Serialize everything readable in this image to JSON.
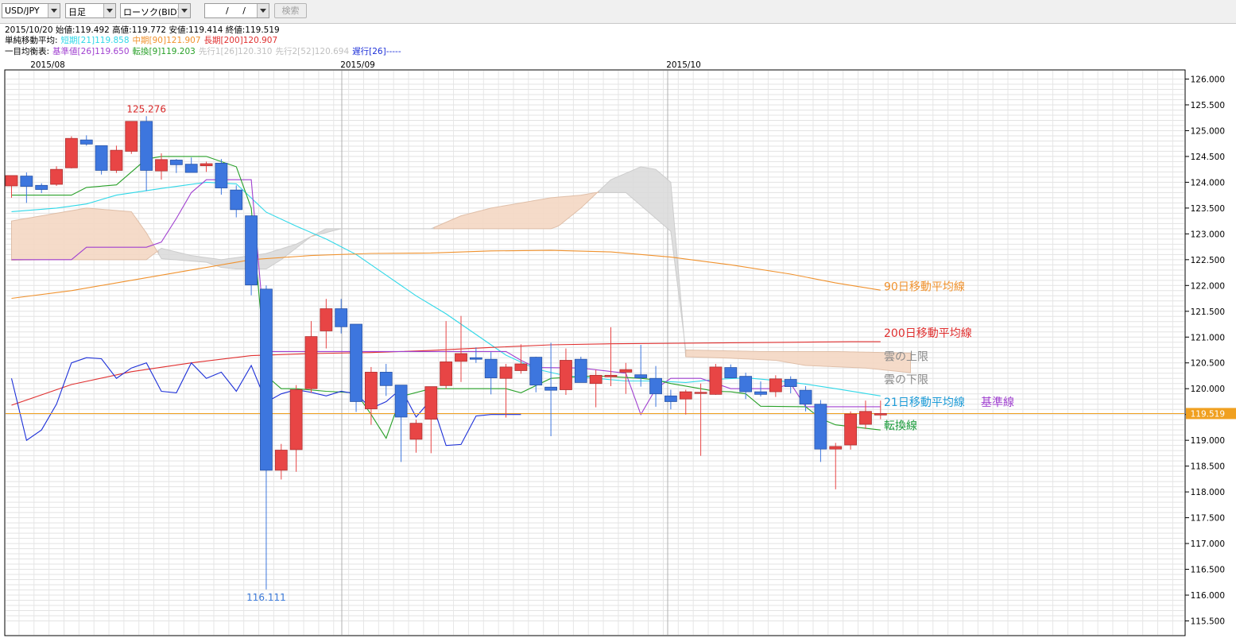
{
  "toolbar": {
    "pair": "USD/JPY",
    "period": "日足",
    "chart_type": "ローソク(BID)",
    "date_value": "/ /",
    "search_label": "検索"
  },
  "info": {
    "ohlc": "2015/10/20  始値:119.492  高値:119.772  安値:119.414  終値:119.519",
    "sma_label": "単純移動平均:",
    "sma_short": "短期[21]119.858",
    "sma_mid": "中期[90]121.907",
    "sma_long": "長期[200]120.907",
    "ichi_label": "一目均衡表:",
    "ichi_kijun": "基準値[26]119.650",
    "ichi_tenkan": "転換[9]119.203",
    "ichi_senko1": "先行1[26]120.310",
    "ichi_senko2": "先行2[52]120.694",
    "ichi_chikou": "遅行[26]-----"
  },
  "colors": {
    "up": "#e84545",
    "down": "#3d76de",
    "sma21": "#2fd8e8",
    "sma90": "#f0922e",
    "sma200": "#e03030",
    "kijun": "#a040d0",
    "tenkan": "#28a028",
    "chikou": "#1c2fd8",
    "cloud_up": "#f5d8c4",
    "cloud_down": "#dcdcdc",
    "price_line": "#f0a020",
    "green_text": "#1a9a3a"
  },
  "chart_data": {
    "type": "candlestick",
    "x_tick_labels": [
      "2015/08",
      "2015/09",
      "2015/10"
    ],
    "y_ticks": [
      "126.000",
      "125.500",
      "125.000",
      "124.500",
      "124.000",
      "123.500",
      "123.000",
      "122.500",
      "122.000",
      "121.500",
      "121.000",
      "120.500",
      "120.000",
      "119.500",
      "119.000",
      "118.500",
      "118.000",
      "117.500",
      "117.000",
      "116.500",
      "116.000",
      "115.500"
    ],
    "ylim": [
      115.5,
      126.0
    ],
    "high_label": "125.276",
    "low_label": "116.111",
    "last_price": 119.519,
    "last_price_label": "119.519",
    "candles": [
      [
        123.93,
        124.1,
        123.7,
        124.13
      ],
      [
        124.12,
        124.19,
        123.6,
        123.92
      ],
      [
        123.94,
        123.98,
        123.79,
        123.86
      ],
      [
        123.96,
        124.31,
        123.93,
        124.25
      ],
      [
        124.28,
        124.89,
        124.27,
        124.85
      ],
      [
        124.82,
        124.91,
        124.71,
        124.74
      ],
      [
        124.71,
        124.71,
        124.15,
        124.23
      ],
      [
        124.23,
        124.71,
        124.18,
        124.62
      ],
      [
        124.6,
        125.17,
        124.55,
        125.18
      ],
      [
        125.18,
        125.28,
        123.83,
        124.23
      ],
      [
        124.22,
        124.56,
        124.05,
        124.44
      ],
      [
        124.43,
        124.45,
        124.18,
        124.34
      ],
      [
        124.35,
        124.48,
        124.23,
        124.19
      ],
      [
        124.32,
        124.4,
        124.2,
        124.36
      ],
      [
        124.37,
        124.45,
        123.76,
        123.89
      ],
      [
        123.85,
        123.94,
        123.32,
        123.47
      ],
      [
        123.35,
        123.36,
        121.81,
        122.01
      ],
      [
        121.93,
        122.0,
        116.11,
        118.42
      ],
      [
        118.42,
        118.93,
        118.24,
        118.81
      ],
      [
        118.82,
        120.07,
        118.39,
        119.98
      ],
      [
        120.0,
        121.31,
        119.92,
        121.01
      ],
      [
        121.12,
        121.74,
        120.78,
        121.55
      ],
      [
        121.55,
        121.74,
        121.07,
        121.2
      ],
      [
        121.25,
        121.25,
        119.55,
        119.75
      ],
      [
        119.61,
        120.42,
        119.3,
        120.32
      ],
      [
        120.32,
        120.48,
        119.86,
        120.06
      ],
      [
        120.07,
        120.07,
        118.58,
        119.45
      ],
      [
        119.02,
        119.4,
        118.76,
        119.33
      ],
      [
        119.41,
        120.04,
        118.75,
        120.04
      ],
      [
        120.06,
        121.31,
        120.0,
        120.52
      ],
      [
        120.53,
        121.41,
        120.13,
        120.68
      ],
      [
        120.6,
        120.8,
        120.5,
        120.57
      ],
      [
        120.57,
        120.71,
        119.89,
        120.21
      ],
      [
        120.2,
        120.48,
        119.44,
        120.42
      ],
      [
        120.35,
        120.86,
        120.29,
        120.48
      ],
      [
        120.61,
        120.62,
        119.93,
        120.07
      ],
      [
        120.03,
        120.89,
        119.08,
        119.97
      ],
      [
        119.98,
        120.78,
        119.88,
        120.55
      ],
      [
        120.57,
        120.62,
        120.13,
        120.12
      ],
      [
        120.1,
        120.37,
        119.64,
        120.26
      ],
      [
        120.23,
        121.19,
        120.05,
        120.26
      ],
      [
        120.32,
        120.5,
        119.9,
        120.37
      ],
      [
        120.27,
        120.85,
        120.04,
        120.21
      ],
      [
        120.2,
        120.44,
        119.65,
        119.9
      ],
      [
        119.86,
        119.98,
        119.6,
        119.75
      ],
      [
        119.8,
        119.98,
        119.5,
        119.94
      ],
      [
        119.93,
        120.1,
        118.7,
        119.93
      ],
      [
        119.89,
        120.48,
        119.88,
        120.42
      ],
      [
        120.41,
        120.47,
        120.23,
        120.21
      ],
      [
        120.24,
        120.31,
        119.8,
        119.94
      ],
      [
        119.94,
        120.14,
        119.85,
        119.89
      ],
      [
        119.94,
        120.26,
        119.84,
        120.19
      ],
      [
        120.18,
        120.24,
        119.91,
        120.04
      ],
      [
        119.97,
        120.05,
        119.56,
        119.7
      ],
      [
        119.7,
        119.78,
        118.58,
        118.83
      ],
      [
        118.83,
        118.95,
        118.05,
        118.88
      ],
      [
        118.91,
        119.56,
        118.82,
        119.51
      ],
      [
        119.31,
        119.77,
        119.22,
        119.56
      ],
      [
        119.49,
        119.77,
        119.41,
        119.52
      ]
    ],
    "series": [
      {
        "key": "sma21",
        "values": [
          [
            0,
            123.43
          ],
          [
            3,
            123.5
          ],
          [
            5,
            123.58
          ],
          [
            7,
            123.75
          ],
          [
            10,
            123.88
          ],
          [
            13,
            124.0
          ],
          [
            15,
            123.97
          ],
          [
            17,
            123.42
          ],
          [
            19,
            123.15
          ],
          [
            21,
            122.9
          ],
          [
            23,
            122.6
          ],
          [
            25,
            122.2
          ],
          [
            27,
            121.8
          ],
          [
            29,
            121.45
          ],
          [
            31,
            121.05
          ],
          [
            33,
            120.65
          ],
          [
            35,
            120.38
          ],
          [
            37,
            120.25
          ],
          [
            39,
            120.2
          ],
          [
            41,
            120.15
          ],
          [
            43,
            120.15
          ],
          [
            45,
            120.12
          ],
          [
            47,
            120.18
          ],
          [
            49,
            120.21
          ],
          [
            51,
            120.16
          ],
          [
            53,
            120.09
          ],
          [
            55,
            120.0
          ],
          [
            58,
            119.86
          ]
        ]
      },
      {
        "key": "sma90",
        "values": [
          [
            0,
            121.75
          ],
          [
            4,
            121.9
          ],
          [
            8,
            122.1
          ],
          [
            12,
            122.3
          ],
          [
            16,
            122.5
          ],
          [
            20,
            122.58
          ],
          [
            24,
            122.62
          ],
          [
            28,
            122.63
          ],
          [
            32,
            122.67
          ],
          [
            36,
            122.68
          ],
          [
            40,
            122.65
          ],
          [
            44,
            122.55
          ],
          [
            48,
            122.4
          ],
          [
            52,
            122.22
          ],
          [
            55,
            122.05
          ],
          [
            58,
            121.91
          ]
        ]
      },
      {
        "key": "sma200",
        "values": [
          [
            0,
            119.68
          ],
          [
            4,
            120.08
          ],
          [
            8,
            120.33
          ],
          [
            12,
            120.5
          ],
          [
            16,
            120.64
          ],
          [
            20,
            120.68
          ],
          [
            24,
            120.7
          ],
          [
            28,
            120.74
          ],
          [
            32,
            120.8
          ],
          [
            36,
            120.85
          ],
          [
            40,
            120.87
          ],
          [
            44,
            120.88
          ],
          [
            48,
            120.89
          ],
          [
            52,
            120.9
          ],
          [
            56,
            120.91
          ],
          [
            58,
            120.91
          ]
        ]
      },
      {
        "key": "kijun",
        "values": [
          [
            0,
            122.5
          ],
          [
            4,
            122.5
          ],
          [
            5,
            122.74
          ],
          [
            9,
            122.74
          ],
          [
            10,
            122.84
          ],
          [
            11,
            123.3
          ],
          [
            12,
            123.8
          ],
          [
            13,
            124.05
          ],
          [
            14,
            124.05
          ],
          [
            15,
            124.05
          ],
          [
            16,
            124.05
          ],
          [
            17,
            120.72
          ],
          [
            23,
            120.72
          ],
          [
            33,
            120.72
          ],
          [
            34,
            120.55
          ],
          [
            35,
            120.41
          ],
          [
            38,
            120.4
          ],
          [
            41,
            120.3
          ],
          [
            42,
            119.5
          ],
          [
            43,
            120.0
          ],
          [
            44,
            120.2
          ],
          [
            46,
            120.2
          ],
          [
            47,
            120.1
          ],
          [
            48,
            120.0
          ],
          [
            50,
            120.0
          ],
          [
            51,
            120.0
          ],
          [
            52,
            120.1
          ],
          [
            53,
            119.65
          ],
          [
            55,
            119.65
          ],
          [
            58,
            119.65
          ]
        ]
      },
      {
        "key": "tenkan",
        "values": [
          [
            0,
            123.75
          ],
          [
            4,
            123.75
          ],
          [
            5,
            123.9
          ],
          [
            7,
            123.95
          ],
          [
            9,
            124.45
          ],
          [
            10,
            124.5
          ],
          [
            13,
            124.5
          ],
          [
            15,
            124.3
          ],
          [
            16,
            123.5
          ],
          [
            17,
            120.25
          ],
          [
            18,
            120.0
          ],
          [
            19,
            120.0
          ],
          [
            21,
            119.95
          ],
          [
            23,
            119.92
          ],
          [
            24,
            119.5
          ],
          [
            25,
            119.04
          ],
          [
            26,
            119.85
          ],
          [
            28,
            120.0
          ],
          [
            33,
            120.0
          ],
          [
            34,
            119.92
          ],
          [
            36,
            120.2
          ],
          [
            39,
            120.25
          ],
          [
            42,
            120.2
          ],
          [
            43,
            120.17
          ],
          [
            44,
            120.1
          ],
          [
            47,
            119.95
          ],
          [
            48,
            119.94
          ],
          [
            49,
            119.9
          ],
          [
            50,
            119.66
          ],
          [
            53,
            119.65
          ],
          [
            54,
            119.42
          ],
          [
            55,
            119.3
          ],
          [
            58,
            119.2
          ]
        ]
      },
      {
        "key": "chikou",
        "values": [
          [
            0,
            120.2
          ],
          [
            1,
            119.0
          ],
          [
            2,
            119.2
          ],
          [
            3,
            119.7
          ],
          [
            4,
            120.5
          ],
          [
            5,
            120.6
          ],
          [
            6,
            120.58
          ],
          [
            7,
            120.2
          ],
          [
            8,
            120.4
          ],
          [
            9,
            120.5
          ],
          [
            10,
            119.95
          ],
          [
            11,
            119.92
          ],
          [
            12,
            120.5
          ],
          [
            13,
            120.2
          ],
          [
            14,
            120.32
          ],
          [
            15,
            119.95
          ],
          [
            16,
            120.45
          ],
          [
            17,
            119.74
          ],
          [
            18,
            119.9
          ],
          [
            19,
            119.98
          ],
          [
            20,
            119.93
          ],
          [
            21,
            119.86
          ],
          [
            22,
            119.95
          ],
          [
            23,
            119.9
          ],
          [
            24,
            119.62
          ],
          [
            25,
            119.75
          ],
          [
            26,
            120.0
          ],
          [
            27,
            119.45
          ],
          [
            28,
            119.79
          ],
          [
            29,
            118.9
          ],
          [
            30,
            118.92
          ],
          [
            31,
            119.47
          ],
          [
            32,
            119.5
          ],
          [
            33,
            119.5
          ],
          [
            34,
            119.5
          ]
        ]
      },
      {
        "key": "senkou_a",
        "values": [
          [
            0,
            122.49
          ],
          [
            3,
            122.5
          ],
          [
            5,
            122.5
          ],
          [
            9,
            122.5
          ],
          [
            10,
            122.72
          ],
          [
            12,
            122.58
          ],
          [
            14,
            122.5
          ],
          [
            17,
            122.62
          ],
          [
            19,
            122.8
          ],
          [
            21,
            123.1
          ],
          [
            23,
            123.1
          ],
          [
            36,
            123.1
          ],
          [
            36.5,
            123.15
          ],
          [
            38,
            123.5
          ],
          [
            40,
            124.05
          ],
          [
            42,
            124.3
          ],
          [
            43,
            124.25
          ],
          [
            44,
            124.0
          ],
          [
            45,
            120.62
          ],
          [
            48,
            120.59
          ],
          [
            51,
            120.55
          ],
          [
            53,
            120.45
          ],
          [
            57,
            120.4
          ],
          [
            60,
            120.31
          ]
        ]
      },
      {
        "key": "senkou_b",
        "values": [
          [
            0,
            123.25
          ],
          [
            5,
            123.5
          ],
          [
            8,
            123.43
          ],
          [
            9,
            123.02
          ],
          [
            10,
            122.52
          ],
          [
            13,
            122.45
          ],
          [
            14,
            122.35
          ],
          [
            15,
            122.32
          ],
          [
            17,
            122.32
          ],
          [
            18,
            122.5
          ],
          [
            20,
            122.95
          ],
          [
            22,
            123.1
          ],
          [
            28,
            123.1
          ],
          [
            30,
            123.35
          ],
          [
            32,
            123.5
          ],
          [
            34,
            123.6
          ],
          [
            36,
            123.7
          ],
          [
            38,
            123.75
          ],
          [
            39,
            123.8
          ],
          [
            40,
            123.8
          ],
          [
            41,
            123.8
          ],
          [
            43,
            123.3
          ],
          [
            44,
            123.05
          ],
          [
            45,
            120.75
          ],
          [
            50,
            120.72
          ],
          [
            55,
            120.72
          ],
          [
            60,
            120.69
          ]
        ]
      }
    ],
    "annotations": [
      {
        "key": "sma90",
        "text": "90日移動平均線",
        "y": 121.98
      },
      {
        "key": "sma200",
        "text": "200日移動平均線",
        "y": 121.08
      },
      {
        "key": "cloud_down",
        "text": "雲の上限",
        "y": 120.63
      },
      {
        "key": "cloud_down",
        "text": "雲の下限",
        "y": 120.18
      },
      {
        "key": "sma21",
        "text": "21日移動平均線",
        "y": 119.74
      },
      {
        "key": "kijun",
        "text": "基準線",
        "y": 119.74,
        "dx": 122
      },
      {
        "key": "tenkan",
        "text": "転換線",
        "y": 119.29
      }
    ]
  }
}
